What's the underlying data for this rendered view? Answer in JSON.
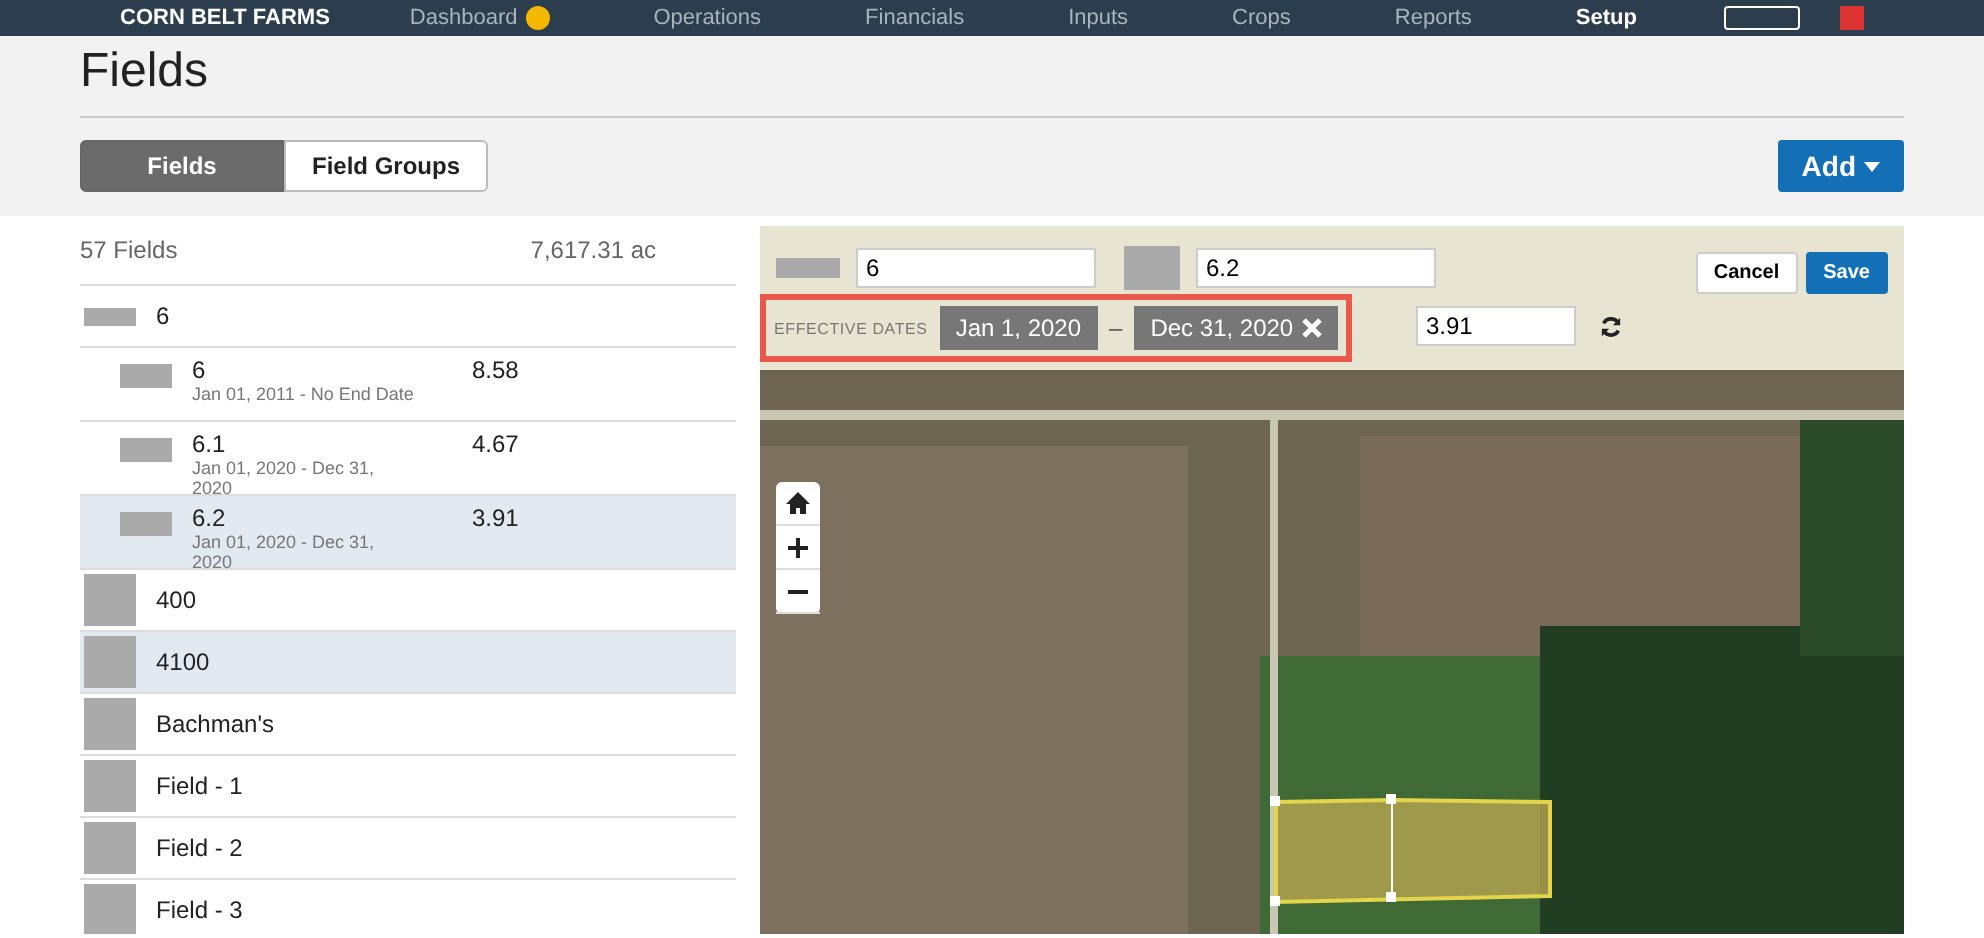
{
  "nav": {
    "brand": "CORN BELT FARMS",
    "items": [
      {
        "label": "Dashboard",
        "selected": false
      },
      {
        "label": "Operations",
        "selected": false
      },
      {
        "label": "Financials",
        "selected": false
      },
      {
        "label": "Inputs",
        "selected": false
      },
      {
        "label": "Crops",
        "selected": false
      },
      {
        "label": "Reports",
        "selected": false
      },
      {
        "label": "Setup",
        "selected": true
      }
    ]
  },
  "page": {
    "title": "Fields",
    "tabs": [
      {
        "label": "Fields",
        "selected": true
      },
      {
        "label": "Field Groups",
        "selected": false
      }
    ],
    "add_button": "Add"
  },
  "field_list": {
    "count": "57 Fields",
    "total_area": "7,617.31 ac",
    "fields": [
      {
        "name": "6",
        "selected": false,
        "children": [
          {
            "name": "6",
            "dates": "Jan 01, 2011 - No End Date",
            "acres": "8.58",
            "selected": false
          },
          {
            "name": "6.1",
            "dates": "Jan 01, 2020 - Dec 31, 2020",
            "acres": "4.67",
            "selected": false
          },
          {
            "name": "6.2",
            "dates": "Jan 01, 2020 - Dec 31, 2020",
            "acres": "3.91",
            "selected": true
          }
        ]
      },
      {
        "name": "400",
        "selected": false
      },
      {
        "name": "4100",
        "selected": true
      },
      {
        "name": "Bachman's",
        "selected": false
      },
      {
        "name": "Field - 1",
        "selected": false
      },
      {
        "name": "Field - 2",
        "selected": false
      },
      {
        "name": "Field - 3",
        "selected": false
      }
    ]
  },
  "editor": {
    "field_name": "6",
    "boundary_name": "6.2",
    "effective_dates": {
      "label": "EFFECTIVE DATES",
      "start": "Jan 1, 2020",
      "separator": "–",
      "end": "Dec 31, 2020",
      "highlighted": true
    },
    "acres": "3.91",
    "cancel": "Cancel",
    "save": "Save"
  }
}
